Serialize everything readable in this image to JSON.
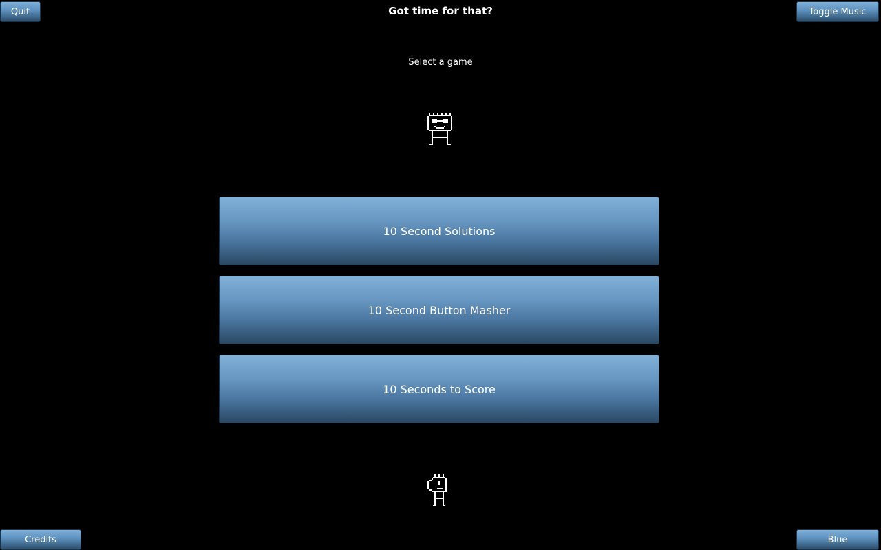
{
  "header": {
    "title": "Got time for that?",
    "subtitle": "Select a game"
  },
  "corner_buttons": {
    "quit": "Quit",
    "toggle_music": "Toggle Music",
    "credits": "Credits",
    "theme": "Blue"
  },
  "games": [
    {
      "label": "10 Second Solutions"
    },
    {
      "label": "10 Second Button Masher"
    },
    {
      "label": "10 Seconds to Score"
    }
  ],
  "icons": {
    "top_character": "pixel-robot-face-icon",
    "bottom_character": "pixel-robot-side-icon"
  },
  "colors": {
    "background": "#000000",
    "button_top": "#81b1d8",
    "button_bottom": "#2a4862",
    "text": "#ffffff"
  }
}
